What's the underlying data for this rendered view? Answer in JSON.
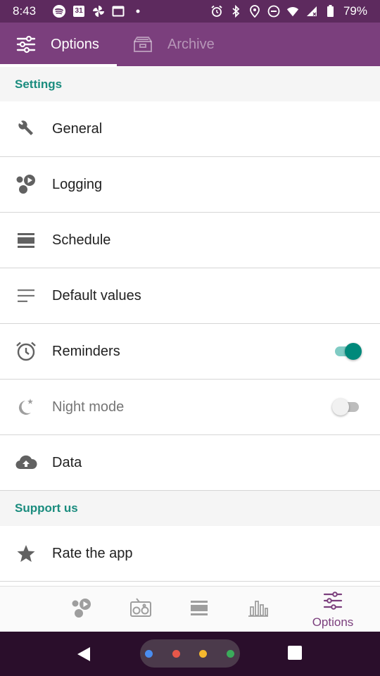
{
  "status_bar": {
    "time": "8:43",
    "battery": "79%",
    "left_icons": [
      "spotify-icon",
      "calendar-icon",
      "pinwheel-icon",
      "screen-icon",
      "dot-icon"
    ],
    "right_icons": [
      "alarm-icon",
      "bluetooth-icon",
      "location-icon",
      "dnd-icon",
      "wifi-icon",
      "signal-icon",
      "battery-icon"
    ],
    "calendar_day": "31"
  },
  "tabs": [
    {
      "label": "Options",
      "icon": "sliders-icon",
      "selected": true
    },
    {
      "label": "Archive",
      "icon": "archive-icon",
      "selected": false
    }
  ],
  "sections": {
    "settings": "Settings",
    "support": "Support us"
  },
  "items": [
    {
      "label": "General",
      "icon": "wrench-icon"
    },
    {
      "label": "Logging",
      "icon": "logging-icon"
    },
    {
      "label": "Schedule",
      "icon": "schedule-icon"
    },
    {
      "label": "Default values",
      "icon": "lines-icon"
    },
    {
      "label": "Reminders",
      "icon": "alarm-clock-icon",
      "toggle": true
    },
    {
      "label": "Night mode",
      "icon": "moon-icon",
      "toggle": false,
      "disabled": true
    },
    {
      "label": "Data",
      "icon": "cloud-upload-icon"
    },
    {
      "label": "Rate the app",
      "icon": "star-icon"
    }
  ],
  "bottom_nav": [
    {
      "icon": "logging-icon",
      "selected": false
    },
    {
      "icon": "radio-icon",
      "selected": false
    },
    {
      "icon": "schedule-icon",
      "selected": false
    },
    {
      "icon": "bar-chart-icon",
      "selected": false
    },
    {
      "icon": "sliders-icon",
      "label": "Options",
      "selected": true
    }
  ],
  "colors": {
    "status_bar": "#5d2a5e",
    "app_bar": "#7b3f7d",
    "accent": "#1a8c7e",
    "toggle_on": "#00897b",
    "nav_selected": "#7b3f7d",
    "system_nav": "#2a0e2b",
    "dot_blue": "#4a8df0",
    "dot_red": "#e8574a",
    "dot_yellow": "#f5b82e",
    "dot_green": "#3bab5b"
  }
}
